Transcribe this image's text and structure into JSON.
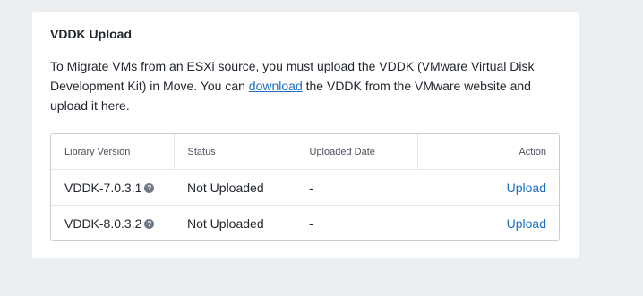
{
  "card": {
    "title": "VDDK Upload",
    "description_before": "To Migrate VMs from an ESXi source, you must upload the VDDK (VMware Virtual Disk Development Kit) in Move. You can ",
    "download_link": "download",
    "description_after": " the VDDK from the VMware website and upload it here."
  },
  "table": {
    "headers": {
      "library_version": "Library Version",
      "status": "Status",
      "uploaded_date": "Uploaded Date",
      "action": "Action"
    },
    "rows": [
      {
        "version": "VDDK-7.0.3.1",
        "help_icon": "question-circle",
        "help_glyph": "?",
        "status": "Not Uploaded",
        "uploaded_date": "-",
        "action": "Upload"
      },
      {
        "version": "VDDK-8.0.3.2",
        "help_icon": "question-circle",
        "help_glyph": "?",
        "status": "Not Uploaded",
        "uploaded_date": "-",
        "action": "Upload"
      }
    ]
  },
  "colors": {
    "page_background": "#eceff2",
    "card_background": "#ffffff",
    "link": "#1b6fc2",
    "help_icon": "#6f7a86"
  }
}
